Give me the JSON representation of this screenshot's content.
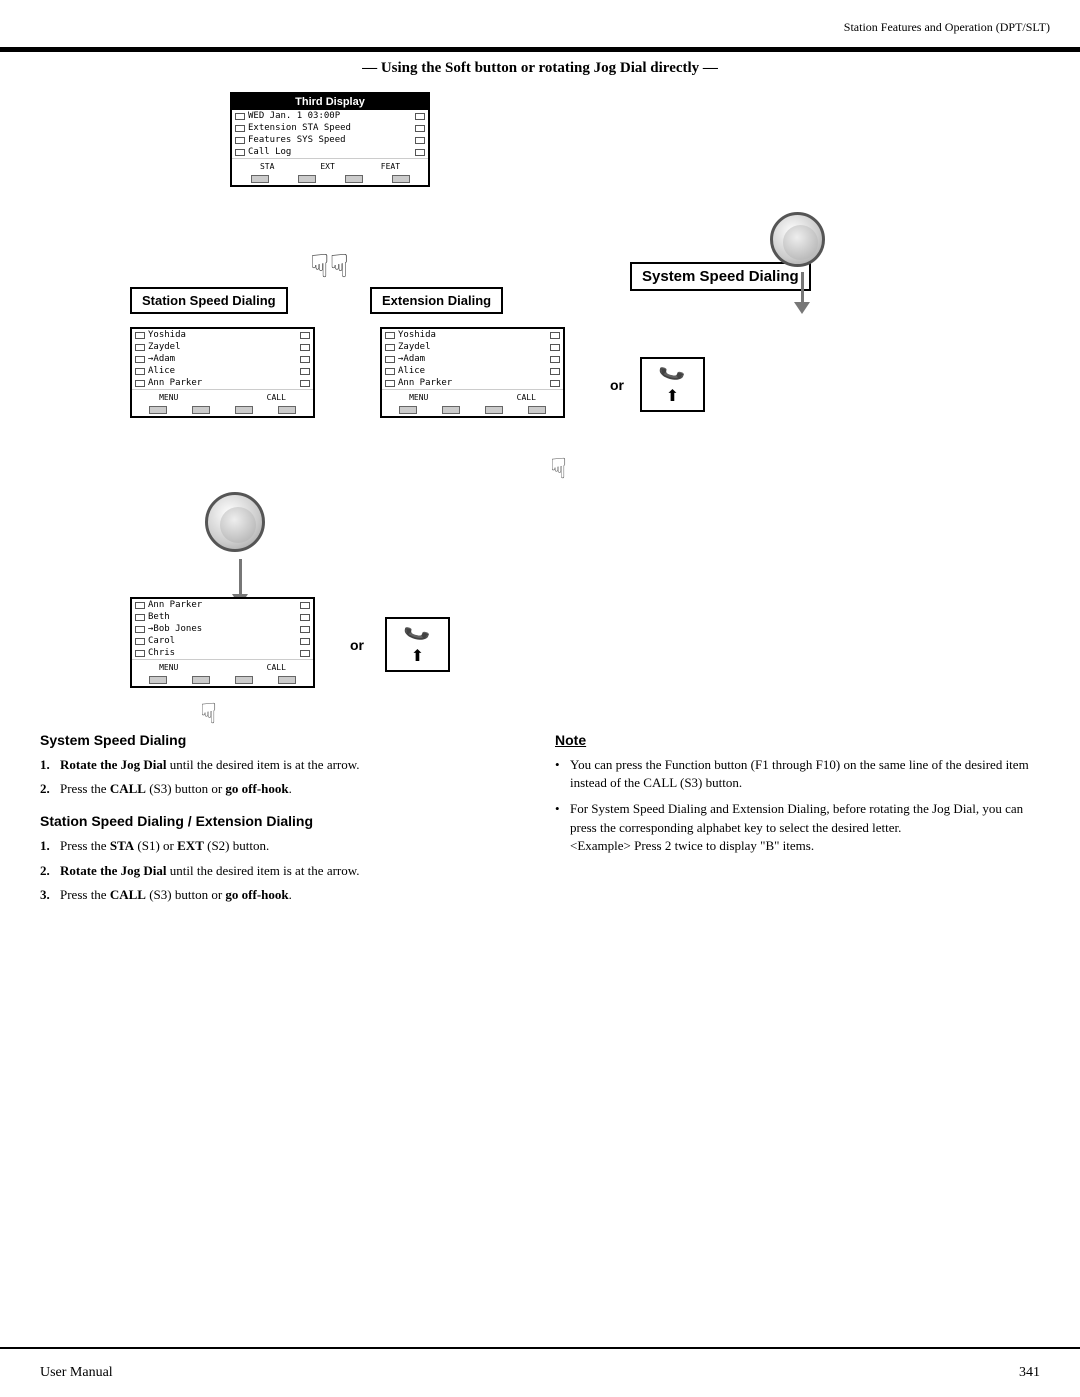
{
  "header": {
    "title": "Station Features and Operation (DPT/SLT)"
  },
  "footer": {
    "left": "User Manual",
    "right": "341"
  },
  "diagram": {
    "title": "— Using the Soft button or rotating Jog Dial directly —",
    "third_display": {
      "title": "Third Display",
      "rows": [
        "WED Jan. 1  03:00P",
        "Extension  STA Speed",
        "Features   SYS Speed",
        "Call Log"
      ],
      "soft_labels": [
        "STA",
        "EXT",
        "FEAT"
      ]
    },
    "station_speed_label": "Station Speed Dialing",
    "extension_dialing_label": "Extension Dialing",
    "system_speed_label": "System Speed Dialing",
    "station_list": {
      "rows": [
        "Yoshida",
        "Zaydel",
        "→Adam",
        "Alice",
        "Ann Parker"
      ],
      "soft_labels": [
        "MENU",
        "CALL"
      ]
    },
    "extension_list": {
      "rows": [
        "Yoshida",
        "Zaydel",
        "→Adam",
        "Alice",
        "Ann Parker"
      ],
      "soft_labels": [
        "MENU",
        "CALL"
      ]
    },
    "scrolled_list": {
      "rows": [
        "Ann Parker",
        "Beth",
        "→Bob Jones",
        "Carol",
        "Chris"
      ],
      "soft_labels": [
        "MENU",
        "CALL"
      ]
    },
    "or_labels": [
      "or",
      "or"
    ]
  },
  "system_speed": {
    "heading": "System Speed Dialing",
    "steps": [
      {
        "num": "1.",
        "text_before": "Rotate the Jog Dial",
        "text_bold": true,
        "content": "Rotate the Jog Dial until the desired item is at the arrow."
      },
      {
        "num": "2.",
        "content": "Press the ",
        "bold_part": "CALL",
        "after": " (S3) button or ",
        "bold2": "go off-hook",
        "after2": "."
      }
    ]
  },
  "station_speed": {
    "heading": "Station Speed Dialing / Extension Dialing",
    "steps": [
      {
        "num": "1.",
        "content": "Press the ",
        "bold1": "STA",
        "mid": " (S1) or ",
        "bold2": "EXT",
        "after": " (S2) button."
      },
      {
        "num": "2.",
        "content": "Rotate the Jog Dial until the desired item is at the arrow."
      },
      {
        "num": "3.",
        "content": "Press the ",
        "bold_part": "CALL",
        "after": " (S3) button or ",
        "bold2": "go off-hook",
        "after2": "."
      }
    ]
  },
  "note": {
    "heading": "Note",
    "bullets": [
      "You can press the Function button (F1 through F10) on the same line of the desired item instead of the CALL (S3) button.",
      "For System Speed Dialing and Extension Dialing, before rotating the Jog Dial, you can press the corresponding alphabet key to select the desired letter.\n<Example> Press 2 twice to display \"B\" items."
    ]
  }
}
